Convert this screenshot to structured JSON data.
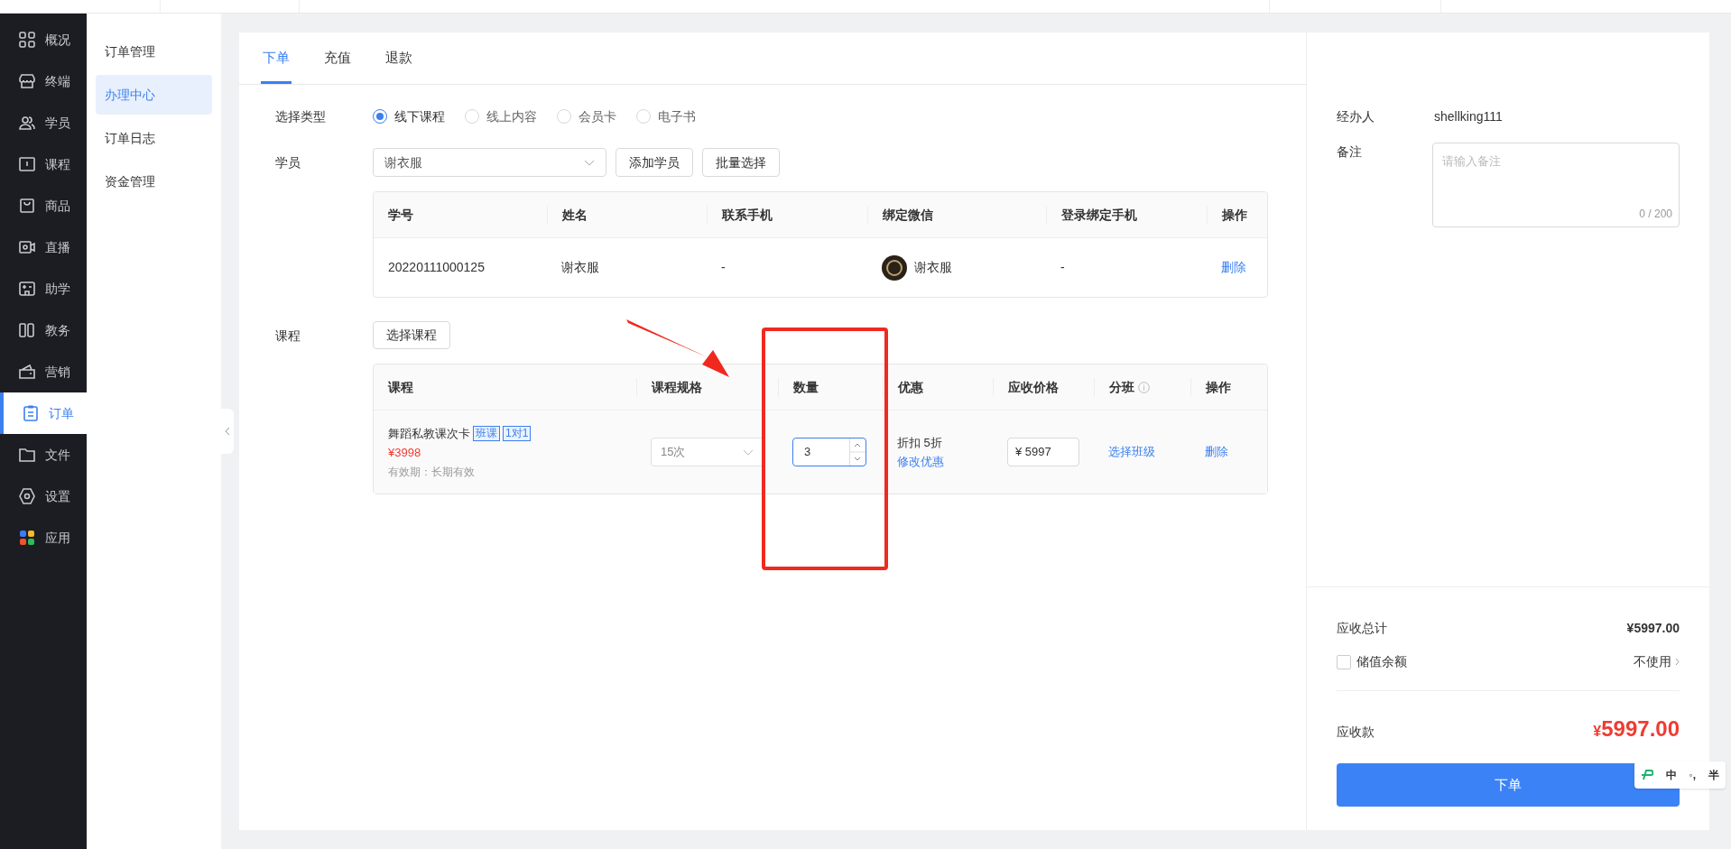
{
  "nav": [
    {
      "label": "概况",
      "selected": false
    },
    {
      "label": "终端",
      "selected": false
    },
    {
      "label": "学员",
      "selected": false
    },
    {
      "label": "课程",
      "selected": false
    },
    {
      "label": "商品",
      "selected": false
    },
    {
      "label": "直播",
      "selected": false
    },
    {
      "label": "助学",
      "selected": false
    },
    {
      "label": "教务",
      "selected": false
    },
    {
      "label": "营销",
      "selected": false
    },
    {
      "label": "订单",
      "selected": true
    },
    {
      "label": "文件",
      "selected": false
    },
    {
      "label": "设置",
      "selected": false
    },
    {
      "label": "应用",
      "selected": false
    }
  ],
  "submenu": [
    {
      "label": "订单管理",
      "selected": false
    },
    {
      "label": "办理中心",
      "selected": true
    },
    {
      "label": "订单日志",
      "selected": false
    },
    {
      "label": "资金管理",
      "selected": false
    }
  ],
  "tabs": [
    {
      "label": "下单",
      "selected": true
    },
    {
      "label": "充值",
      "selected": false
    },
    {
      "label": "退款",
      "selected": false
    }
  ],
  "form": {
    "type_label": "选择类型",
    "types": [
      {
        "label": "线下课程",
        "selected": true
      },
      {
        "label": "线上内容",
        "selected": false
      },
      {
        "label": "会员卡",
        "selected": false
      },
      {
        "label": "电子书",
        "selected": false
      }
    ],
    "student_label": "学员",
    "student_select": "谢衣服",
    "student_buttons": [
      "添加学员",
      "批量选择"
    ],
    "student_table": {
      "columns": [
        "学号",
        "姓名",
        "联系手机",
        "绑定微信",
        "登录绑定手机",
        "操作"
      ],
      "rows": [
        {
          "id": "20220111000125",
          "name": "谢衣服",
          "phone": "-",
          "wechat": "谢衣服",
          "login_phone": "-",
          "action": "删除"
        }
      ]
    },
    "course_label": "课程",
    "course_button": "选择课程",
    "course_table": {
      "columns": [
        {
          "label": "课程",
          "info": false
        },
        {
          "label": "课程规格",
          "info": false
        },
        {
          "label": "数量",
          "info": false
        },
        {
          "label": "优惠",
          "info": false
        },
        {
          "label": "应收价格",
          "info": false
        },
        {
          "label": "分班",
          "info": true
        },
        {
          "label": "操作",
          "info": false
        }
      ],
      "rows": [
        {
          "name": "舞蹈私教课次卡",
          "tags": [
            "班课",
            "1对1"
          ],
          "price": "¥3998",
          "validity": "有效期：长期有效",
          "spec": "15次",
          "quantity": "3",
          "discount": "折扣 5折",
          "discount_link": "修改优惠",
          "receivable": "¥ 5997",
          "class_link": "选择班级",
          "action": "删除"
        }
      ]
    }
  },
  "side": {
    "handler_label": "经办人",
    "handler": "shellking111",
    "note_label": "备注",
    "note_placeholder": "请输入备注",
    "note_count": "0 / 200",
    "total_label": "应收总计",
    "total": "¥5997.00",
    "balance_label": "储值余额",
    "balance_checked": false,
    "balance_value": "不使用",
    "due_label": "应收款",
    "due_currency": "¥",
    "due_amount": "5997.00",
    "submit": "下单"
  },
  "ime": [
    "中",
    "◦,",
    "半"
  ]
}
